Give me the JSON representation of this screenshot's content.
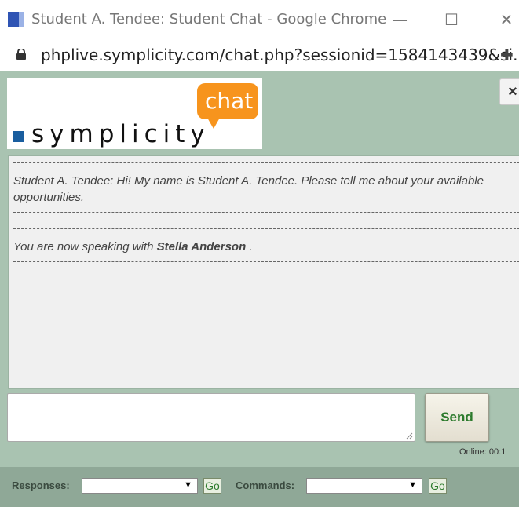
{
  "window": {
    "title": "Student A. Tendee: Student Chat - Google Chrome",
    "minimize_glyph": "—",
    "maximize_glyph": "☐",
    "close_glyph": "✕"
  },
  "address_bar": {
    "url": "phplive.symplicity.com/chat.php?sessionid=1584143439&si..."
  },
  "logo": {
    "brand": "symplicity",
    "badge": "chat"
  },
  "close_button": {
    "label": "×"
  },
  "chat": {
    "messages": [
      {
        "text": "Student A. Tendee: Hi! My name is Student A. Tendee. Please tell me about your available opportunities."
      },
      {
        "prefix": "You are now speaking with",
        "name": "Stella Anderson",
        "suffix": " ."
      }
    ]
  },
  "composer": {
    "send_label": "Send"
  },
  "status": {
    "online": "Online: 00:1"
  },
  "footer": {
    "responses_label": "Responses:",
    "responses_value": "",
    "responses_go": "Go",
    "commands_label": "Commands:",
    "commands_value": "",
    "commands_go": "Go"
  },
  "colors": {
    "page_bg": "#a9c3b1",
    "chat_badge": "#f7941d",
    "brand_square": "#1a5e9f",
    "send_text": "#2c7a2c"
  }
}
